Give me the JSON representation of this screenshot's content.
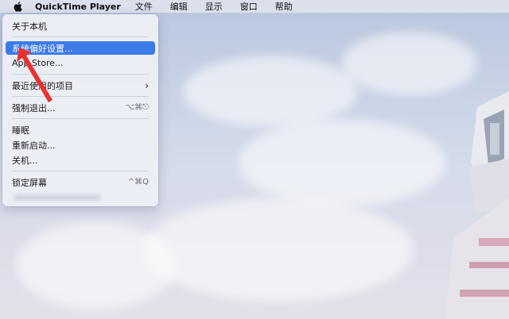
{
  "menubar": {
    "app_name": "QuickTime Player",
    "menus": [
      "文件",
      "编辑",
      "显示",
      "窗口",
      "帮助"
    ]
  },
  "apple_menu": {
    "about": "关于本机",
    "system_prefs": "系统偏好设置...",
    "app_store": "App Store...",
    "recent_items": "最近使用的项目",
    "force_quit": "强制退出...",
    "force_quit_shortcut": "⌥⌘⎋",
    "sleep": "睡眠",
    "restart": "重新启动...",
    "shutdown": "关机...",
    "lock_screen": "锁定屏幕",
    "lock_screen_shortcut": "^⌘Q"
  },
  "colors": {
    "highlight": "#3d7ae8",
    "arrow": "#e8322e"
  }
}
